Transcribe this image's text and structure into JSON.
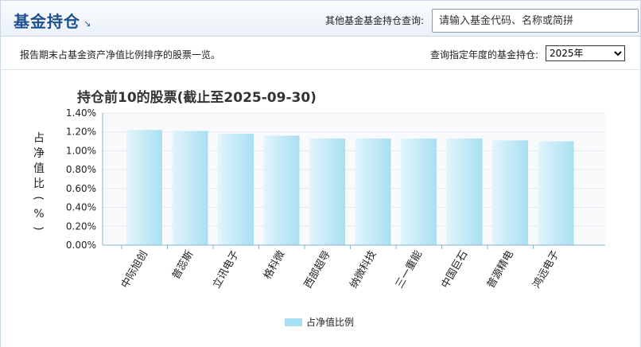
{
  "header": {
    "title": "基金持仓",
    "arrow": "↘",
    "search_label": "其他基金基金持仓查询:",
    "search_placeholder": "请输入基金代码、名称或简拼"
  },
  "subbar": {
    "description": "报告期末占基金资产净值比例排序的股票一览。",
    "year_label": "查询指定年度的基金持仓:",
    "year_selected": "2025年"
  },
  "colors": {
    "bar_top": "#a9dff2",
    "bar_bottom": "#e2f5fc",
    "axis": "#8ab4d4",
    "grid": "#e4e8ec"
  },
  "chart_data": {
    "type": "bar",
    "title": "持仓前10的股票(截止至2025-09-30)",
    "ylabel": "占净值比(%)",
    "categories": [
      "中际旭创",
      "普蕊斯",
      "立讯电子",
      "格科微",
      "西部超导",
      "纳微科技",
      "三一重能",
      "中国巨石",
      "普源精电",
      "鸿远电子"
    ],
    "series": [
      {
        "name": "占净值比例",
        "values": [
          1.22,
          1.21,
          1.18,
          1.16,
          1.13,
          1.13,
          1.13,
          1.13,
          1.11,
          1.1
        ]
      }
    ],
    "ylim": [
      0,
      1.4
    ],
    "yticks": [
      "0.00%",
      "0.20%",
      "0.40%",
      "0.60%",
      "0.80%",
      "1.00%",
      "1.20%",
      "1.40%"
    ],
    "grid": true,
    "legend": "bottom-center"
  }
}
